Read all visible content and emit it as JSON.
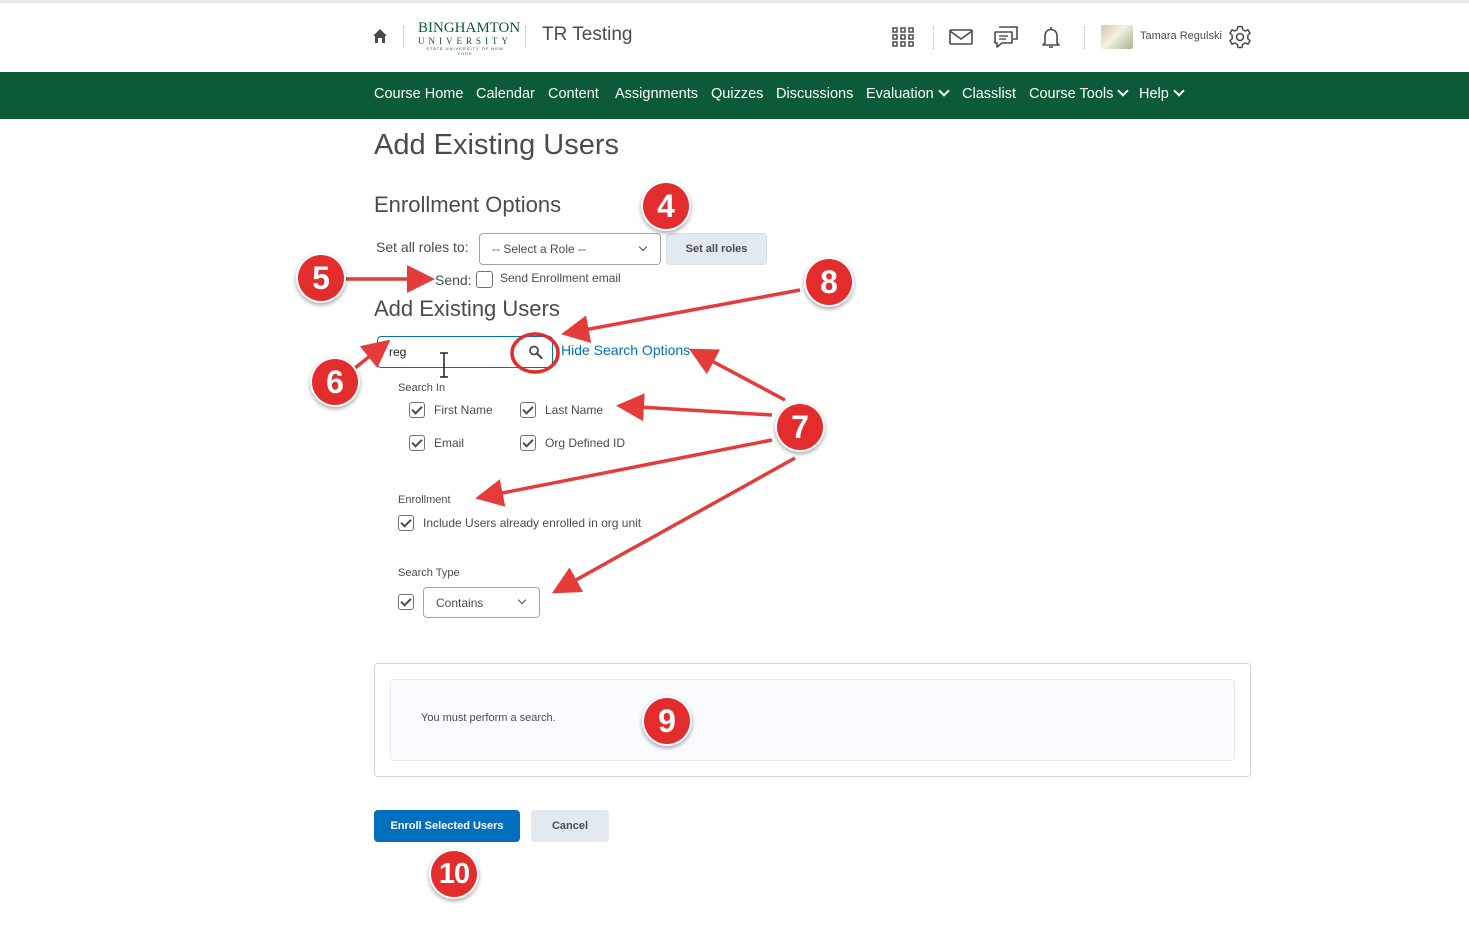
{
  "header": {
    "logo_line1": "BINGHAMTON",
    "logo_line2": "UNIVERSITY",
    "logo_line3": "STATE UNIVERSITY OF NEW YORK",
    "course_title": "TR Testing",
    "user_name": "Tamara Regulski",
    "icons": [
      "home-icon",
      "app-grid-icon",
      "mail-icon",
      "chat-icon",
      "bell-icon",
      "gear-icon"
    ]
  },
  "nav": {
    "items": [
      "Course Home",
      "Calendar",
      "Content",
      "Assignments",
      "Quizzes",
      "Discussions",
      "Evaluation",
      "Classlist",
      "Course Tools",
      "Help"
    ]
  },
  "page": {
    "title": "Add Existing Users",
    "enrollment_options": "Enrollment Options",
    "set_all_roles_label": "Set all roles to:",
    "role_select_value": "-- Select a Role --",
    "set_all_roles_button": "Set all roles",
    "send_label": "Send:",
    "send_email_label": "Send Enrollment email",
    "add_existing_heading": "Add Existing Users",
    "search_value": "reg",
    "hide_search_options": "Hide Search Options",
    "search_in_label": "Search In",
    "first_name": "First Name",
    "last_name": "Last Name",
    "email": "Email",
    "org_defined_id": "Org Defined ID",
    "enrollment_label": "Enrollment",
    "include_enrolled": "Include Users already enrolled in org unit",
    "search_type_label": "Search Type",
    "search_type_value": "Contains",
    "results_message": "You must perform a search.",
    "enroll_button": "Enroll Selected Users",
    "cancel_button": "Cancel"
  },
  "annotations": {
    "badges": [
      "4",
      "5",
      "6",
      "7",
      "8",
      "9",
      "10"
    ],
    "badge_color": "#e32d2d"
  },
  "colors": {
    "nav_bg": "#0b5a38",
    "primary": "#006fbf",
    "text": "#494c4e"
  }
}
